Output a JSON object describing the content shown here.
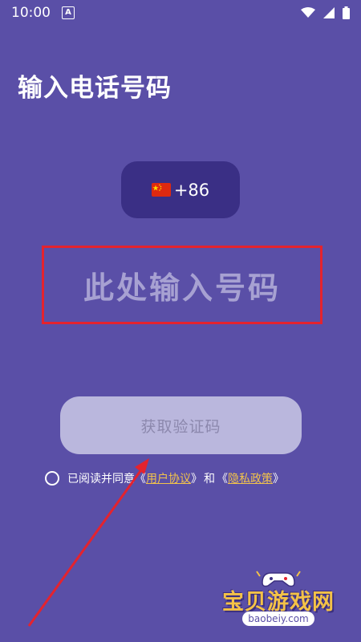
{
  "status_bar": {
    "time": "10:00",
    "app_badge": "A"
  },
  "header": {
    "title": "输入电话号码"
  },
  "country": {
    "code": "+86",
    "flag_icon": "china-flag-icon"
  },
  "phone_input": {
    "placeholder": "此处输入号码"
  },
  "code_button": {
    "label": "获取验证码"
  },
  "agreement": {
    "prefix": "已阅读并同意",
    "open_quote1": "《",
    "user_agreement": "用户协议",
    "close_quote1": "》",
    "and_text": "和",
    "open_quote2": "《",
    "privacy_policy": "隐私政策",
    "close_quote2": "》"
  },
  "watermark": {
    "name": "宝贝游戏网",
    "url": "baobeiy.com"
  },
  "colors": {
    "background": "#5a4fa7",
    "country_button": "#3a2f85",
    "input_border": "#e4232e",
    "code_button": "#bab7dd",
    "link": "#f2c34b"
  }
}
